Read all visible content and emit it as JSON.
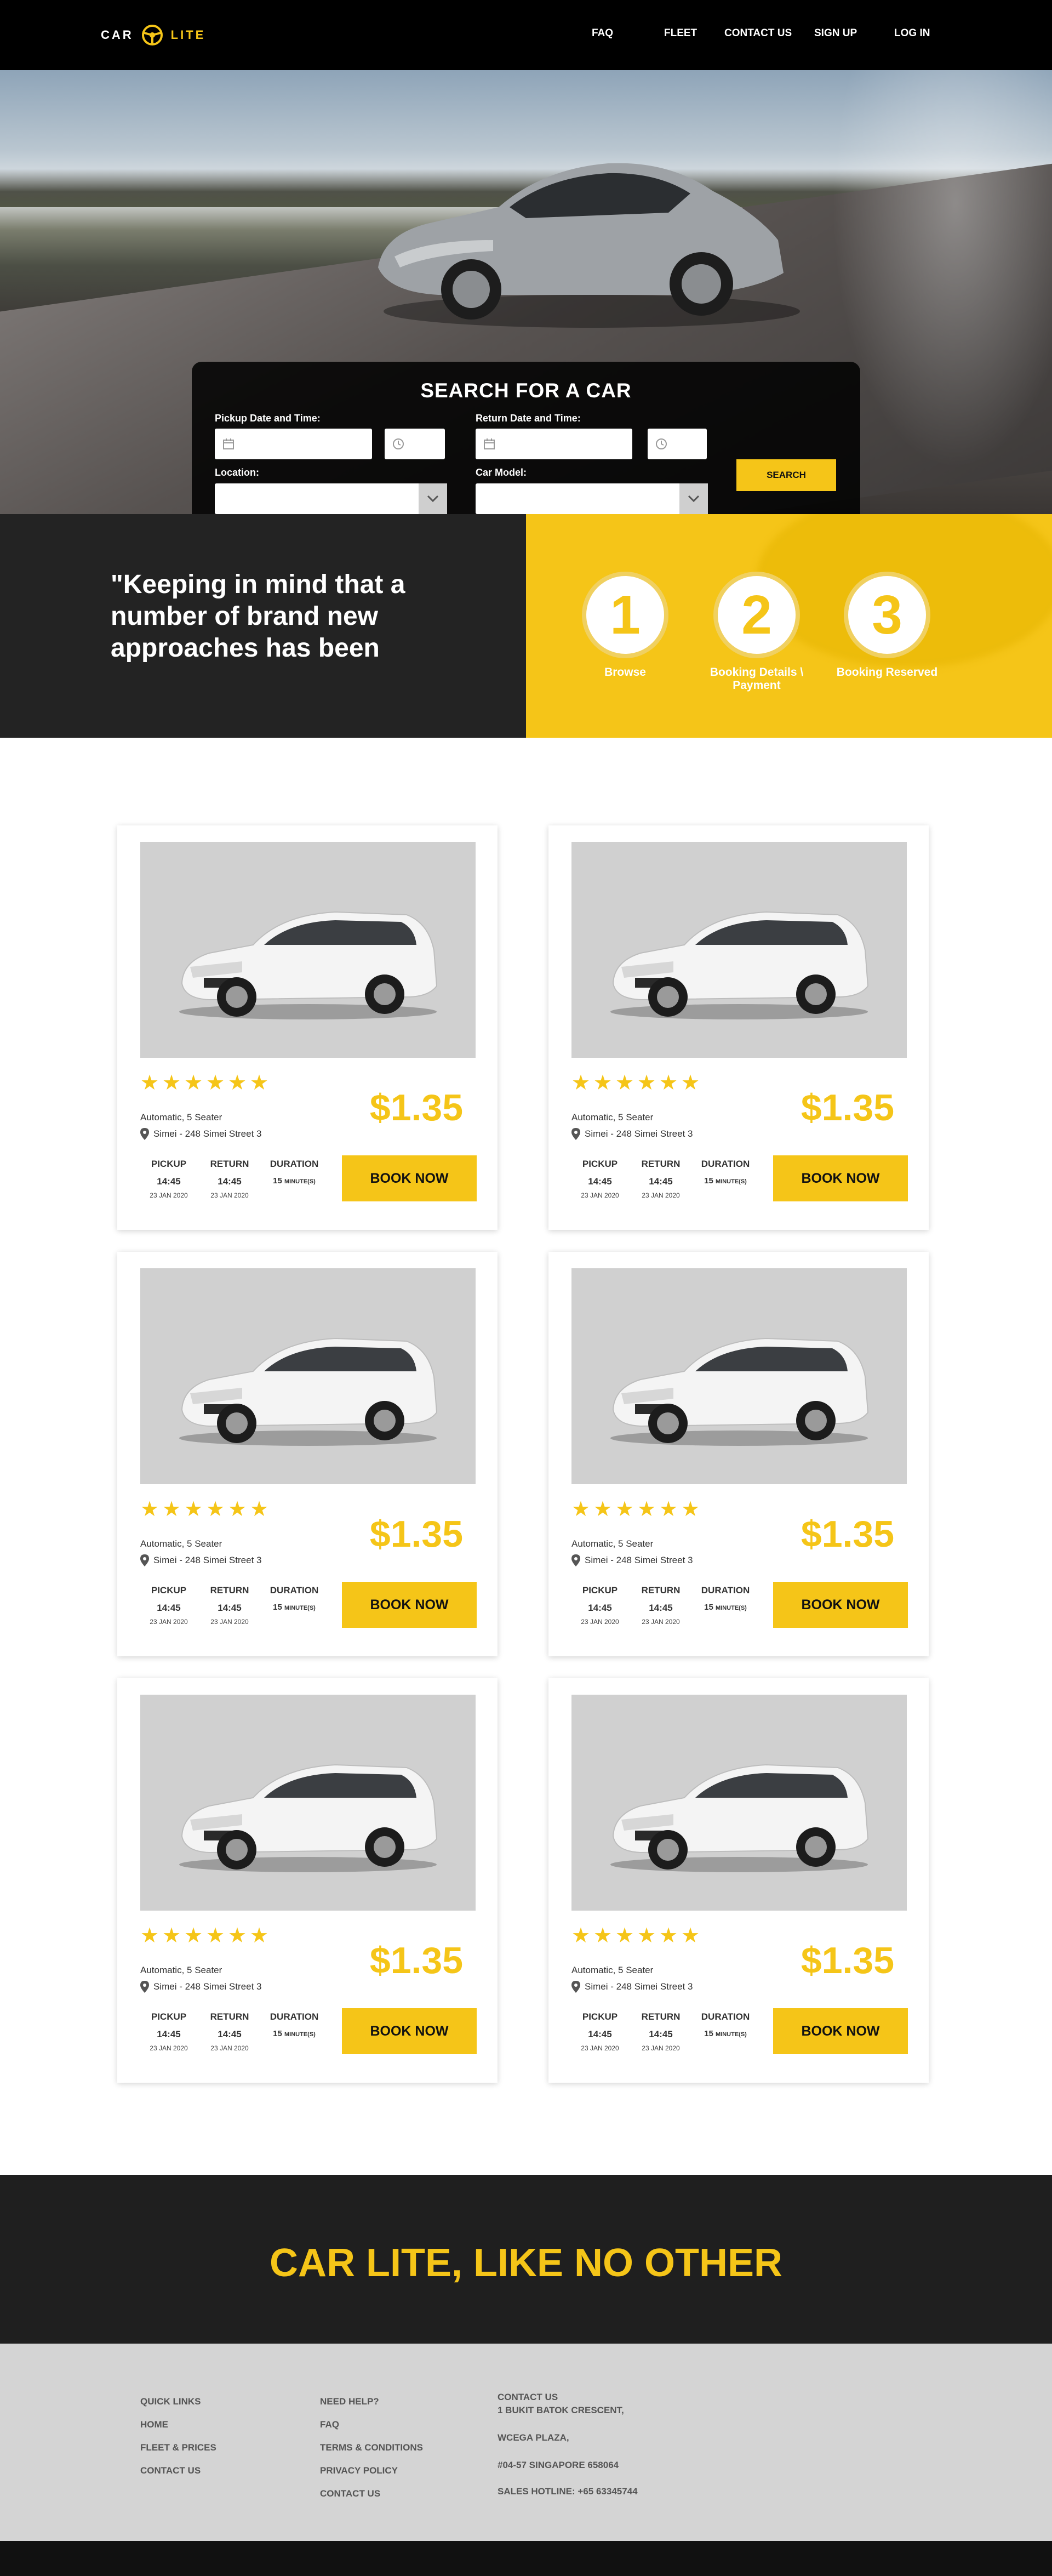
{
  "brand": {
    "part1": "CAR",
    "part2": "LITE"
  },
  "nav": {
    "faq": "FAQ",
    "fleet": "FLEET",
    "contact": "CONTACT US",
    "signup": "SIGN UP",
    "login": "LOG IN"
  },
  "search": {
    "title": "SEARCH FOR A CAR",
    "pickup_label": "Pickup Date and Time:",
    "return_label": "Return Date and Time:",
    "location_label": "Location:",
    "model_label": "Car Model:",
    "button": "SEARCH"
  },
  "steps": {
    "quote": "\"Keeping in mind that a number of brand new approaches has been",
    "items": [
      {
        "num": "1",
        "caption": "Browse"
      },
      {
        "num": "2",
        "caption": "Booking Details \\ Payment"
      },
      {
        "num": "3",
        "caption": "Booking Reserved"
      }
    ]
  },
  "cards": [
    {
      "spec": "Automatic, 5 Seater",
      "location": "Simei - 248 Simei Street 3",
      "price": "$1.35",
      "rating": 6,
      "pickup_h": "PICKUP",
      "return_h": "RETURN",
      "duration_h": "DURATION",
      "pickup_time": "14:45",
      "return_time": "14:45",
      "duration": "15",
      "duration_unit": "MINUTE(S)",
      "pickup_date": "23 JAN 2020",
      "return_date": "23 JAN 2020",
      "button": "BOOK NOW"
    },
    {
      "spec": "Automatic, 5 Seater",
      "location": "Simei - 248 Simei Street 3",
      "price": "$1.35",
      "rating": 6,
      "pickup_h": "PICKUP",
      "return_h": "RETURN",
      "duration_h": "DURATION",
      "pickup_time": "14:45",
      "return_time": "14:45",
      "duration": "15",
      "duration_unit": "MINUTE(S)",
      "pickup_date": "23 JAN 2020",
      "return_date": "23 JAN 2020",
      "button": "BOOK NOW"
    },
    {
      "spec": "Automatic, 5 Seater",
      "location": "Simei - 248 Simei Street 3",
      "price": "$1.35",
      "rating": 6,
      "pickup_h": "PICKUP",
      "return_h": "RETURN",
      "duration_h": "DURATION",
      "pickup_time": "14:45",
      "return_time": "14:45",
      "duration": "15",
      "duration_unit": "MINUTE(S)",
      "pickup_date": "23 JAN 2020",
      "return_date": "23 JAN 2020",
      "button": "BOOK NOW"
    },
    {
      "spec": "Automatic, 5 Seater",
      "location": "Simei - 248 Simei Street 3",
      "price": "$1.35",
      "rating": 6,
      "pickup_h": "PICKUP",
      "return_h": "RETURN",
      "duration_h": "DURATION",
      "pickup_time": "14:45",
      "return_time": "14:45",
      "duration": "15",
      "duration_unit": "MINUTE(S)",
      "pickup_date": "23 JAN 2020",
      "return_date": "23 JAN 2020",
      "button": "BOOK NOW"
    },
    {
      "spec": "Automatic, 5 Seater",
      "location": "Simei - 248 Simei Street 3",
      "price": "$1.35",
      "rating": 6,
      "pickup_h": "PICKUP",
      "return_h": "RETURN",
      "duration_h": "DURATION",
      "pickup_time": "14:45",
      "return_time": "14:45",
      "duration": "15",
      "duration_unit": "MINUTE(S)",
      "pickup_date": "23 JAN 2020",
      "return_date": "23 JAN 2020",
      "button": "BOOK NOW"
    },
    {
      "spec": "Automatic, 5 Seater",
      "location": "Simei - 248 Simei Street 3",
      "price": "$1.35",
      "rating": 6,
      "pickup_h": "PICKUP",
      "return_h": "RETURN",
      "duration_h": "DURATION",
      "pickup_time": "14:45",
      "return_time": "14:45",
      "duration": "15",
      "duration_unit": "MINUTE(S)",
      "pickup_date": "23 JAN 2020",
      "return_date": "23 JAN 2020",
      "button": "BOOK NOW"
    }
  ],
  "tagline": "CAR LITE, LIKE NO OTHER",
  "footer": {
    "quick_links": {
      "title": "QUICK LINKS",
      "home": "HOME",
      "fleet": "FLEET & PRICES",
      "contact": "CONTACT US"
    },
    "help": {
      "title": "NEED HELP?",
      "faq": "FAQ",
      "terms": "TERMS & CONDITIONS",
      "privacy": "PRIVACY POLICY",
      "contact": "CONTACT US"
    },
    "contact": {
      "title": "CONTACT US",
      "line1": "1 BUKIT BATOK CRESCENT,",
      "line2": "WCEGA PLAZA,",
      "line3": "#04-57 SINGAPORE 658064",
      "hotline": "SALES HOTLINE: +65 63345744"
    }
  },
  "colors": {
    "accent": "#f5c518",
    "dark": "#232323",
    "header": "#000000",
    "footer": "#d4d4d4"
  },
  "icons": [
    "steering-wheel-icon",
    "calendar-icon",
    "clock-icon",
    "chevron-down-icon",
    "star-icon",
    "map-pin-icon"
  ]
}
